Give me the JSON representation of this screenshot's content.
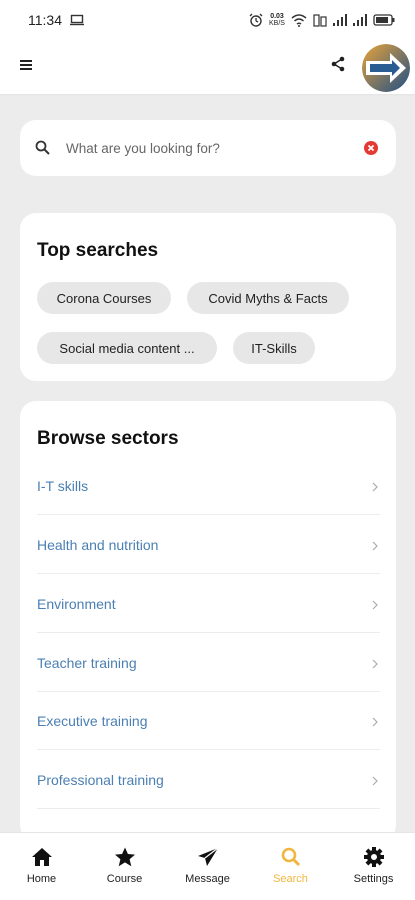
{
  "status_bar": {
    "time": "11:34",
    "net_speed_value": "0.03",
    "net_speed_unit": "KB/S"
  },
  "search": {
    "placeholder": "What are you looking for?"
  },
  "top_searches": {
    "title": "Top searches",
    "chips": [
      {
        "label": "Corona Courses"
      },
      {
        "label": "Covid Myths & Facts"
      },
      {
        "label": "Social media content ..."
      },
      {
        "label": "IT-Skills"
      }
    ]
  },
  "browse": {
    "title": "Browse sectors",
    "sectors": [
      {
        "label": "I-T skills"
      },
      {
        "label": "Health and nutrition"
      },
      {
        "label": "Environment"
      },
      {
        "label": "Teacher training"
      },
      {
        "label": "Executive training"
      },
      {
        "label": "Professional training"
      }
    ]
  },
  "bottom_nav": {
    "items": [
      {
        "label": "Home",
        "icon": "home-icon"
      },
      {
        "label": "Course",
        "icon": "star-icon"
      },
      {
        "label": "Message",
        "icon": "send-icon"
      },
      {
        "label": "Search",
        "icon": "search-icon"
      },
      {
        "label": "Settings",
        "icon": "gear-icon"
      }
    ],
    "active": "Search"
  },
  "colors": {
    "accent": "#f0b640",
    "link": "#4a7fb3",
    "clear": "#e53935",
    "background": "#ececec"
  }
}
